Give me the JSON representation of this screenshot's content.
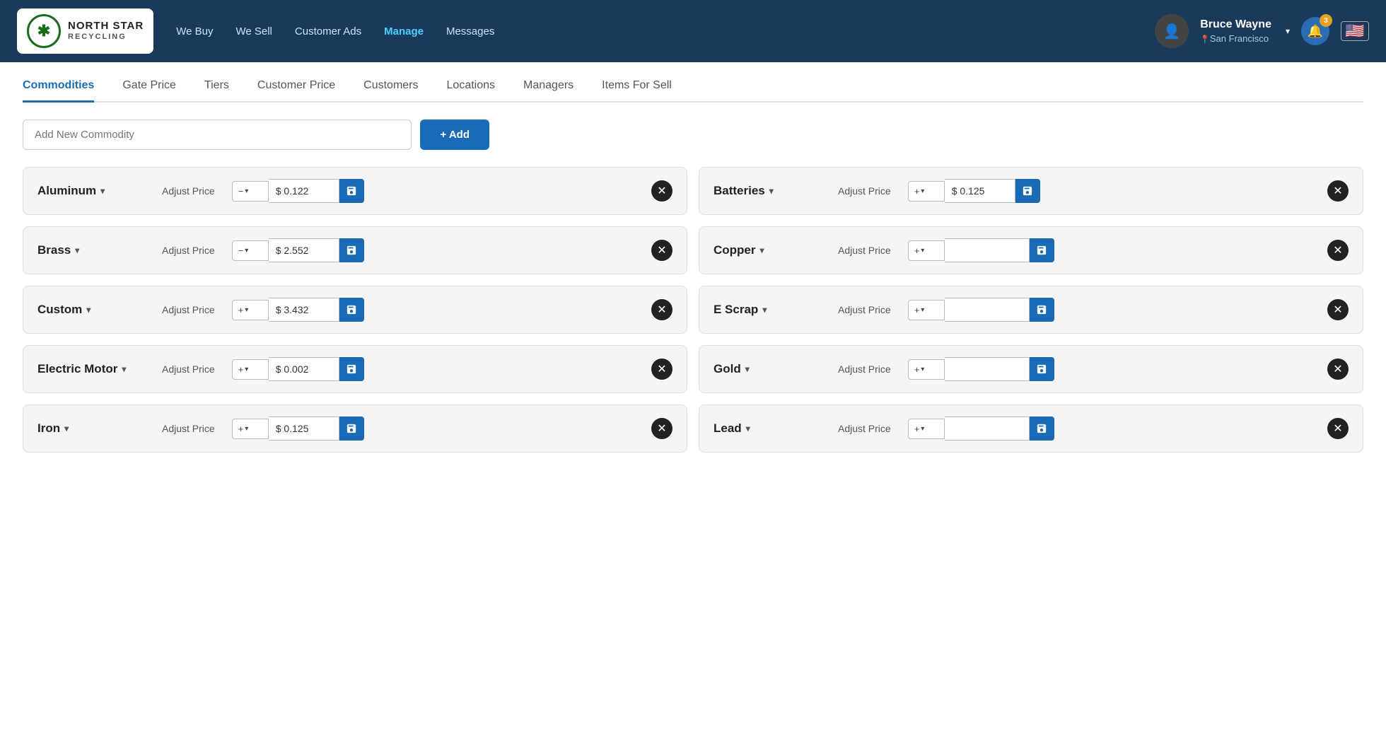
{
  "header": {
    "logo_line1": "NORTH STAR",
    "logo_line2": "RECYCLING",
    "logo_symbol": "✿",
    "nav": [
      {
        "label": "We Buy",
        "active": false
      },
      {
        "label": "We Sell",
        "active": false
      },
      {
        "label": "Customer Ads",
        "active": false
      },
      {
        "label": "Manage",
        "active": true
      },
      {
        "label": "Messages",
        "active": false
      }
    ],
    "user_name": "Bruce Wayne",
    "user_location": "San Francisco",
    "notif_count": "3",
    "flag_emoji": "🇺🇸"
  },
  "tabs": [
    {
      "label": "Commodities",
      "active": true
    },
    {
      "label": "Gate Price",
      "active": false
    },
    {
      "label": "Tiers",
      "active": false
    },
    {
      "label": "Customer Price",
      "active": false
    },
    {
      "label": "Customers",
      "active": false
    },
    {
      "label": "Locations",
      "active": false
    },
    {
      "label": "Managers",
      "active": false
    },
    {
      "label": "Items For Sell",
      "active": false
    }
  ],
  "add_commodity": {
    "placeholder": "Add New Commodity",
    "button_label": "+ Add"
  },
  "commodities": [
    {
      "name": "Aluminum",
      "sign": "−",
      "price": "$ 0.122",
      "has_price": true
    },
    {
      "name": "Batteries",
      "sign": "+",
      "price": "$ 0.125",
      "has_price": true
    },
    {
      "name": "Brass",
      "sign": "−",
      "price": "$ 2.552",
      "has_price": true
    },
    {
      "name": "Copper",
      "sign": "+",
      "price": "",
      "has_price": false
    },
    {
      "name": "Custom",
      "sign": "+",
      "price": "$ 3.432",
      "has_price": true
    },
    {
      "name": "E Scrap",
      "sign": "+",
      "price": "",
      "has_price": false
    },
    {
      "name": "Electric Motor",
      "sign": "+",
      "price": "$ 0.002",
      "has_price": true
    },
    {
      "name": "Gold",
      "sign": "+",
      "price": "",
      "has_price": false
    },
    {
      "name": "Iron",
      "sign": "+",
      "price": "$ 0.125",
      "has_price": true
    },
    {
      "name": "Lead",
      "sign": "+",
      "price": "",
      "has_price": false
    }
  ],
  "labels": {
    "adjust_price": "Adjust Price",
    "chevron": "▾",
    "save_icon": "💾",
    "remove_icon": "✕"
  }
}
